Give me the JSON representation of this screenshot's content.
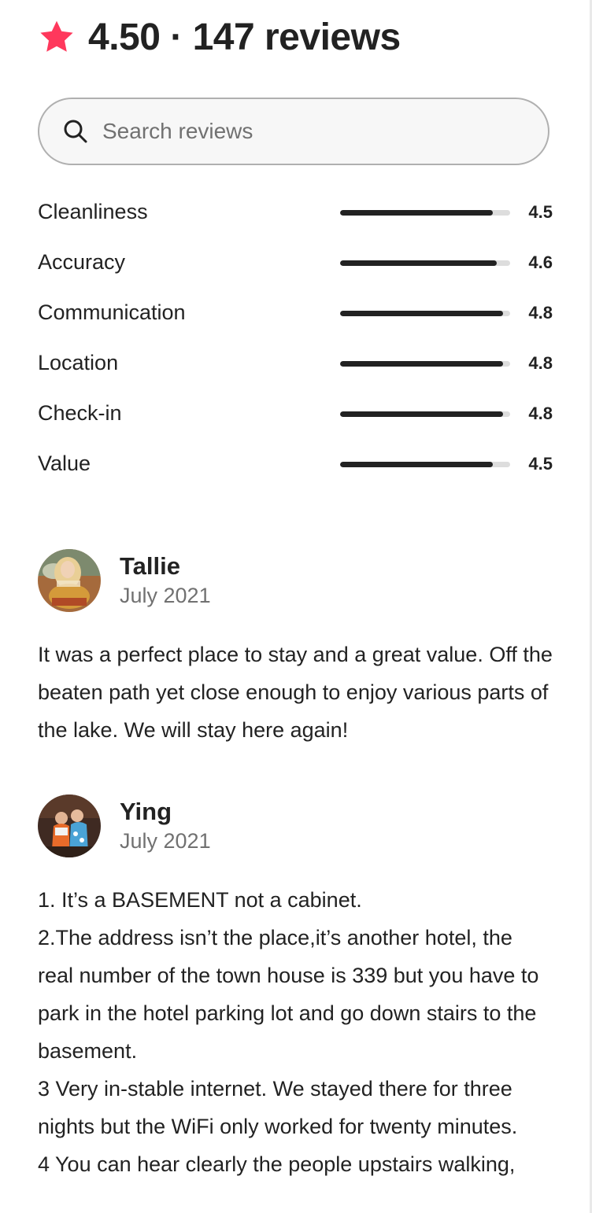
{
  "header": {
    "title": "4.50 · 147 reviews",
    "star_icon": "star-icon",
    "accent_color": "#FF385C"
  },
  "search": {
    "placeholder": "Search reviews",
    "value": "",
    "icon": "search-icon"
  },
  "ratings": [
    {
      "label": "Cleanliness",
      "value": "4.5",
      "score": 4.5,
      "max": 5
    },
    {
      "label": "Accuracy",
      "value": "4.6",
      "score": 4.6,
      "max": 5
    },
    {
      "label": "Communication",
      "value": "4.8",
      "score": 4.8,
      "max": 5
    },
    {
      "label": "Location",
      "value": "4.8",
      "score": 4.8,
      "max": 5
    },
    {
      "label": "Check-in",
      "value": "4.8",
      "score": 4.8,
      "max": 5
    },
    {
      "label": "Value",
      "value": "4.5",
      "score": 4.5,
      "max": 5
    }
  ],
  "reviews": [
    {
      "name": "Tallie",
      "date": "July 2021",
      "lines": [
        "It was a perfect place to stay and a great value. Off the beaten path yet close enough to enjoy various parts of the lake. We will stay here again!"
      ]
    },
    {
      "name": "Ying",
      "date": "July 2021",
      "lines": [
        "1. It’s a BASEMENT not a cabinet.",
        "2.The address isn’t the place,it’s another hotel, the real number of the town house is 339 but you have to park in the hotel parking lot and go down stairs to the basement.",
        "3 Very in-stable internet. We stayed there for three nights but the WiFi only worked for twenty minutes.",
        "4 You can hear clearly the people upstairs walking,"
      ]
    }
  ]
}
